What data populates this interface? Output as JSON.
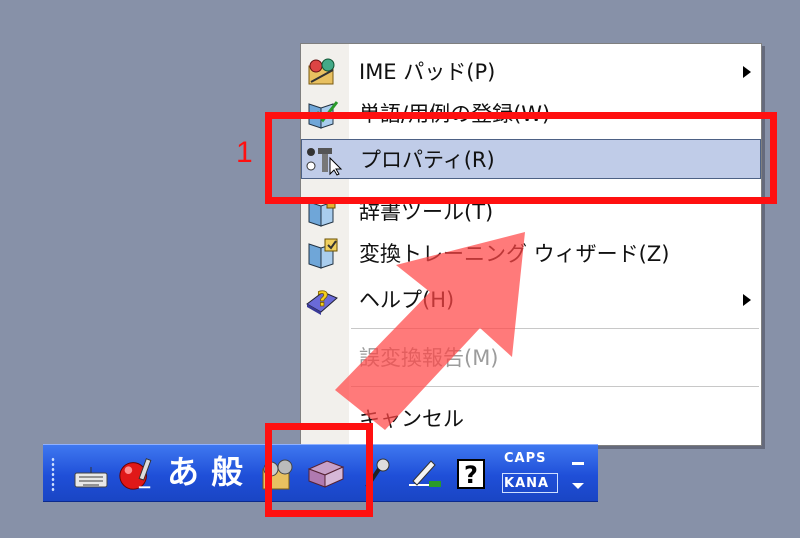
{
  "menu": {
    "items": [
      {
        "label": "IME パッド(P)",
        "submenu": true,
        "disabled": false,
        "icon": "ime-pad-icon"
      },
      {
        "label": "単語/用例の登録(W)",
        "submenu": false,
        "disabled": false,
        "icon": "word-register-icon"
      },
      {
        "label": "プロパティ(R)",
        "submenu": false,
        "disabled": false,
        "highlighted": true,
        "icon": "properties-icon"
      },
      {
        "label": "辞書ツール(T)",
        "submenu": false,
        "disabled": false,
        "icon": "dictionary-tool-icon"
      },
      {
        "label": "変換トレーニング ウィザード(Z)",
        "submenu": false,
        "disabled": false,
        "icon": "training-wizard-icon"
      },
      {
        "label": "ヘルプ(H)",
        "submenu": true,
        "disabled": false,
        "icon": "help-book-icon"
      },
      {
        "label": "誤変換報告(M)",
        "submenu": false,
        "disabled": true
      },
      {
        "label": "キャンセル",
        "submenu": false,
        "disabled": false
      }
    ]
  },
  "langbar": {
    "input_mode": "あ",
    "conversion_mode": "般",
    "caps": "CAPS",
    "kana": "KANA"
  },
  "annotation": {
    "step_number": "1",
    "color": "#ff1010"
  }
}
